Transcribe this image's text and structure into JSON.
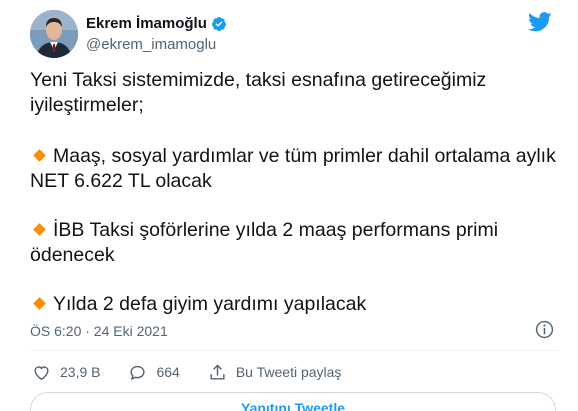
{
  "author": {
    "display_name": "Ekrem İmamoğlu",
    "handle": "@ekrem_imamoglu",
    "verified": true
  },
  "tweet": {
    "intro": "Yeni Taksi sistemimizde, taksi esnafına getireceğimiz iyileştirmeler;",
    "items": [
      "Maaş, sosyal yardımlar ve tüm primler dahil ortalama aylık NET 6.622 TL olacak",
      "İBB Taksi şoförlerine yılda 2 maaş performans primi ödenecek",
      "Yılda 2 defa giyim yardımı yapılacak"
    ],
    "timestamp": "ÖS 6:20 · 24 Eki 2021"
  },
  "actions": {
    "like_count": "23,9 B",
    "comment_count": "664",
    "share_label": "Bu Tweeti paylaş"
  },
  "reply_button_label": "Yanıtını Tweetle",
  "colors": {
    "accent": "#1d9bf0",
    "diamond": "#f4900c",
    "secondary_text": "#536471"
  },
  "icons": [
    "verified-badge-icon",
    "twitter-bird-icon",
    "info-icon",
    "heart-icon",
    "comment-icon",
    "share-icon",
    "orange-diamond-icon"
  ]
}
